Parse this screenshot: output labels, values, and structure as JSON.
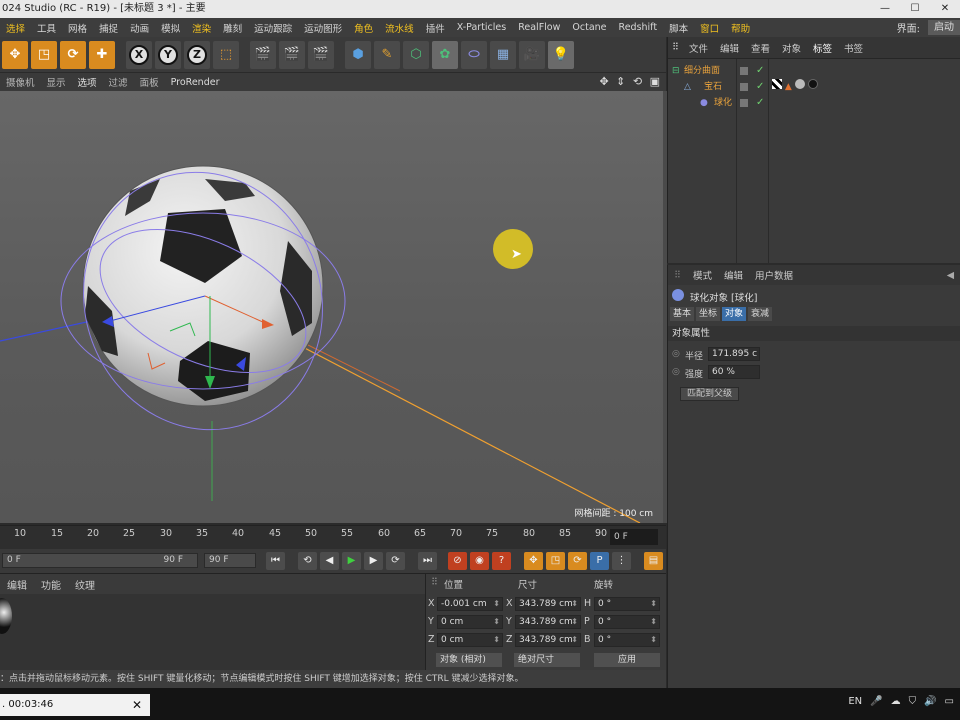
{
  "titlebar": {
    "title": "024 Studio (RC - R19) - [未标题 3 *] - 主要",
    "minimize": "—",
    "maximize": "☐",
    "close": "✕"
  },
  "menubar": {
    "items": [
      "选择",
      "工具",
      "网格",
      "捕捉",
      "动画",
      "模拟",
      "渲染",
      "雕刻",
      "运动跟踪",
      "运动图形",
      "角色",
      "流水线",
      "插件",
      "X-Particles",
      "RealFlow",
      "Octane",
      "Redshift",
      "脚本",
      "窗口",
      "帮助"
    ],
    "layout_label": "界面:",
    "layout_value": "启动"
  },
  "toolbar": {
    "buttons": [
      "move-tool",
      "scale-tool",
      "rotate-tool",
      "live-selection",
      "x-axis",
      "y-axis",
      "z-axis",
      "coordinate-system",
      "render-view",
      "render-picture-viewer",
      "render-settings",
      "cube",
      "pen",
      "subdivision",
      "cloner",
      "deformer",
      "floor",
      "camera",
      "light"
    ],
    "x_label": "X",
    "y_label": "Y",
    "z_label": "Z"
  },
  "viewport_menu": {
    "items": [
      "摄像机",
      "显示",
      "选项",
      "过滤",
      "面板",
      "ProRender"
    ],
    "nav_icons": "✥ ⇕ ⟲ ▣"
  },
  "viewport": {
    "grid_spacing": "网格间距 : 100 cm"
  },
  "timeline": {
    "ticks": [
      "10",
      "15",
      "20",
      "25",
      "30",
      "35",
      "40",
      "45",
      "50",
      "55",
      "60",
      "65",
      "70",
      "75",
      "80",
      "85",
      "90"
    ],
    "current_frame": "0 F"
  },
  "playbar": {
    "start": "0 F",
    "end": "90 F",
    "max": "90 F"
  },
  "material_panel": {
    "tabs": [
      "编辑",
      "功能",
      "纹理"
    ]
  },
  "coordinates": {
    "headers": {
      "position": "位置",
      "size": "尺寸",
      "rotation": "旋转"
    },
    "rows": [
      {
        "axis": "X",
        "pos": "-0.001 cm",
        "size_axis": "X",
        "size": "343.789 cm",
        "rot_axis": "H",
        "rot": "0 °"
      },
      {
        "axis": "Y",
        "pos": "0 cm",
        "size_axis": "Y",
        "size": "343.789 cm",
        "rot_axis": "P",
        "rot": "0 °"
      },
      {
        "axis": "Z",
        "pos": "0 cm",
        "size_axis": "Z",
        "size": "343.789 cm",
        "rot_axis": "B",
        "rot": "0 °"
      }
    ],
    "mode": "对象 (相对)",
    "size_mode": "绝对尺寸",
    "apply": "应用"
  },
  "statusbar": {
    "text": "：点击并拖动鼠标移动元素。按住 SHIFT 键量化移动；节点编辑模式时按住 SHIFT 键增加选择对象；按住 CTRL 键减少选择对象。"
  },
  "object_manager": {
    "tabs": [
      "文件",
      "编辑",
      "查看",
      "对象",
      "标签",
      "书签"
    ],
    "objects": [
      {
        "name": "细分曲面",
        "level": 0,
        "check": "✓"
      },
      {
        "name": "宝石",
        "level": 1,
        "check": "✓"
      },
      {
        "name": "球化",
        "level": 2,
        "check": "✓"
      }
    ]
  },
  "attribute_manager": {
    "tabs": [
      "模式",
      "编辑",
      "用户数据"
    ],
    "object_title": "球化对象 [球化]",
    "subtabs": [
      "基本",
      "坐标",
      "对象",
      "衰减"
    ],
    "section": "对象属性",
    "params": [
      {
        "label": "半径",
        "value": "171.895 c"
      },
      {
        "label": "强度",
        "value": "60 %"
      }
    ],
    "fit_button": "匹配到父级"
  },
  "taskbar": {
    "timer": ". 00:03:46",
    "close": "✕",
    "tray": [
      "EN",
      "🎤",
      "☁",
      "⛉",
      "🔊",
      "▭"
    ]
  },
  "colors": {
    "accent_orange": "#d98b1f",
    "accent_blue": "#3a6ea8",
    "object_name": "#e8a23c",
    "cursor_highlight": "#e6cd1e"
  }
}
